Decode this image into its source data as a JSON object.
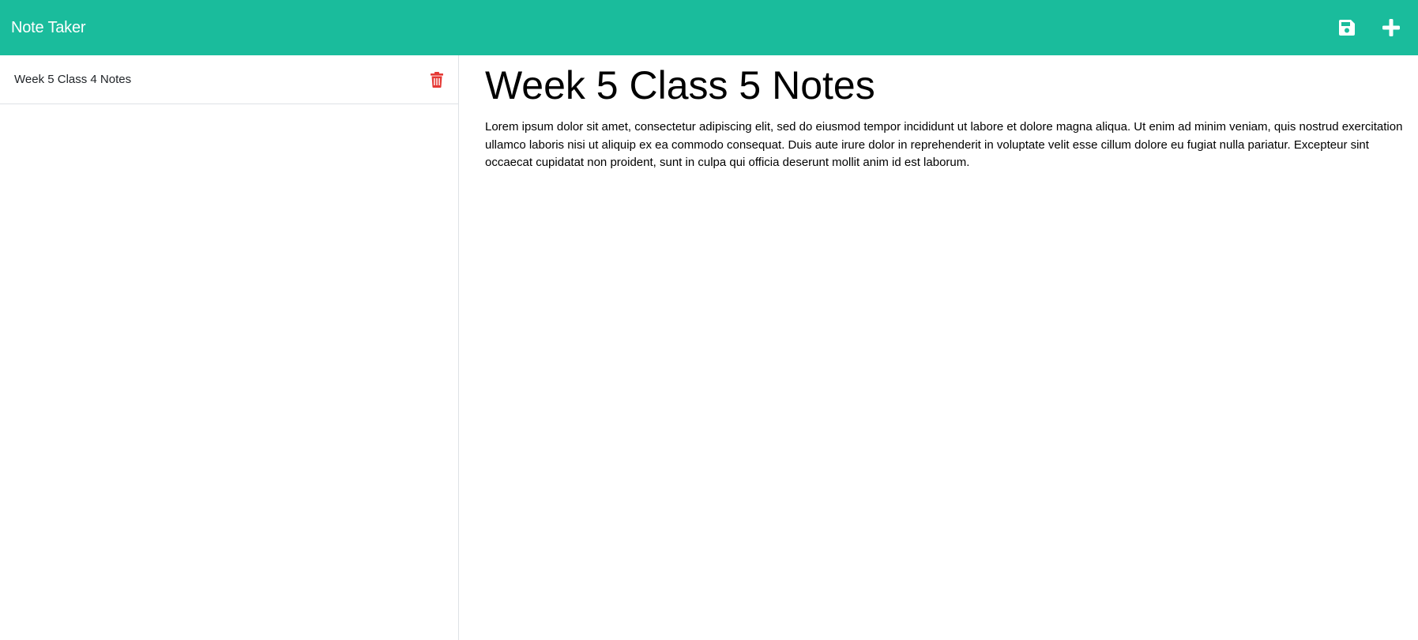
{
  "navbar": {
    "brand": "Note Taker",
    "save_icon": "save-icon",
    "add_icon": "plus-icon",
    "color": "#1abc9c"
  },
  "sidebar": {
    "notes": [
      {
        "title": "Week 5 Class 4 Notes",
        "delete_icon": "trash-icon",
        "delete_color": "#e53935"
      }
    ]
  },
  "main": {
    "note_title": "Week 5 Class 5 Notes",
    "note_text": "Lorem ipsum dolor sit amet, consectetur adipiscing elit, sed do eiusmod tempor incididunt ut labore et dolore magna aliqua. Ut enim ad minim veniam, quis nostrud exercitation ullamco laboris nisi ut aliquip ex ea commodo consequat. Duis aute irure dolor in reprehenderit in voluptate velit esse cillum dolore eu fugiat nulla pariatur. Excepteur sint occaecat cupidatat non proident, sunt in culpa qui officia deserunt mollit anim id est laborum."
  }
}
